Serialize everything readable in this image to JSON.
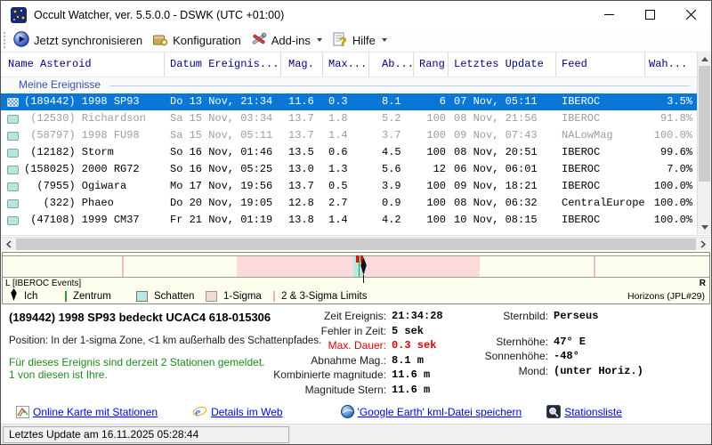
{
  "window": {
    "title": "Occult Watcher, ver. 5.5.0.0 - DSWK (UTC +01:00)",
    "status_bar": "Letztes Update am 16.11.2025 05:28:44"
  },
  "toolbar": {
    "sync": "Jetzt synchronisieren",
    "config": "Konfiguration",
    "addins": "Add-ins",
    "hilfe": "Hilfe"
  },
  "table": {
    "headers": [
      "Name Asteroid",
      "Datum Ereignis...",
      "Mag.",
      "Max...",
      "Ab...",
      "Rang",
      "Letztes Update",
      "Feed",
      "Wah..."
    ],
    "group": "Meine Ereignisse",
    "rows": [
      {
        "name": "(189442) 1998 SP93",
        "datum": "Do 13 Nov, 21:34",
        "mag": "11.6",
        "max": "0.3",
        "ab": "8.1",
        "rang": "6",
        "update": "07 Nov, 05:11",
        "feed": "IBEROC",
        "wah": "3.5%",
        "state": "selected"
      },
      {
        "name": " (12530) Richardson",
        "datum": "Sa 15 Nov, 03:34",
        "mag": "13.7",
        "max": "1.8",
        "ab": "5.2",
        "rang": "100",
        "update": "08 Nov, 21:56",
        "feed": "IBEROC",
        "wah": "91.8%",
        "state": "dim"
      },
      {
        "name": " (58797) 1998 FU98",
        "datum": "Sa 15 Nov, 05:11",
        "mag": "13.7",
        "max": "1.4",
        "ab": "3.7",
        "rang": "100",
        "update": "09 Nov, 07:43",
        "feed": "NALowMag",
        "wah": "100.0%",
        "state": "dim"
      },
      {
        "name": " (12182) Storm",
        "datum": "So 16 Nov, 01:46",
        "mag": "13.5",
        "max": "0.6",
        "ab": "4.5",
        "rang": "100",
        "update": "08 Nov, 20:51",
        "feed": "IBEROC",
        "wah": "99.6%",
        "state": "normal"
      },
      {
        "name": "(158025) 2000 RG72",
        "datum": "So 16 Nov, 05:25",
        "mag": "13.0",
        "max": "1.3",
        "ab": "5.6",
        "rang": "12",
        "update": "06 Nov, 06:01",
        "feed": "IBEROC",
        "wah": "7.0%",
        "state": "normal"
      },
      {
        "name": "  (7955) Ogiwara",
        "datum": "Mo 17 Nov, 19:56",
        "mag": "13.7",
        "max": "0.5",
        "ab": "3.9",
        "rang": "100",
        "update": "09 Nov, 18:21",
        "feed": "IBEROC",
        "wah": "100.0%",
        "state": "normal"
      },
      {
        "name": "   (322) Phaeo",
        "datum": "Do 20 Nov, 19:05",
        "mag": "12.8",
        "max": "2.7",
        "ab": "0.9",
        "rang": "100",
        "update": "08 Nov, 06:32",
        "feed": "CentralEurope",
        "wah": "100.0%",
        "state": "normal"
      },
      {
        "name": " (47108) 1999 CM37",
        "datum": "Fr 21 Nov, 01:19",
        "mag": "13.8",
        "max": "1.4",
        "ab": "4.2",
        "rang": "100",
        "update": "10 Nov, 08:15",
        "feed": "IBEROC",
        "wah": "100.0%",
        "state": "normal"
      }
    ]
  },
  "timeline": {
    "left_label": "L [IBEROC Events]",
    "right_label": "R",
    "source": "Horizons (JPL#29)",
    "legend": [
      {
        "symbol": "black-diamond",
        "label": "Ich"
      },
      {
        "symbol": "green-line",
        "label": "Zentrum"
      },
      {
        "symbol": "teal-square",
        "label": "Schatten"
      },
      {
        "symbol": "pink-square",
        "label": "1-Sigma"
      },
      {
        "symbol": "pink-line",
        "label": "2 & 3-Sigma Limits"
      }
    ],
    "colors": {
      "shadow": "#b8e8e4",
      "sigma": "#fadada",
      "center": "#2f9e2f",
      "tick": "#e31212"
    }
  },
  "details": {
    "title": "(189442) 1998 SP93 bedeckt UCAC4 618-015306",
    "position": "Position:  In der 1-sigma Zone, <1 km außerhalb des Schattenpfades.",
    "stations1": "Für dieses Ereignis sind derzeit 2 Stationen gemeldet.",
    "stations2": "1 von diesen ist Ihre.",
    "fields_mid": [
      {
        "label": "Zeit Ereignis:",
        "value": "21:34:28"
      },
      {
        "label": "Fehler in Zeit:",
        "value": "5 sek"
      },
      {
        "label": "Max. Dauer:",
        "value": "0.3 sek",
        "color": "red"
      },
      {
        "label": "Abnahme Mag.:",
        "value": "8.1 m"
      },
      {
        "label": "Kombinierte magnitude:",
        "value": "11.6 m"
      },
      {
        "label": "Magnitude Stern:",
        "value": "11.6 m"
      }
    ],
    "fields_right": [
      {
        "label": "Sternbild:",
        "value": "Perseus"
      },
      {
        "label": "Sternhöhe:",
        "value": "47° E",
        "gap": true
      },
      {
        "label": "Sonnenhöhe:",
        "value": "-48°"
      },
      {
        "label": "Mond:",
        "value": "(unter Horiz.)"
      }
    ]
  },
  "links": [
    {
      "label": "Online Karte mit Stationen"
    },
    {
      "label": "Details im Web"
    },
    {
      "label": "'Google Earth' kml-Datei speichern"
    },
    {
      "label": "Stationsliste"
    }
  ]
}
